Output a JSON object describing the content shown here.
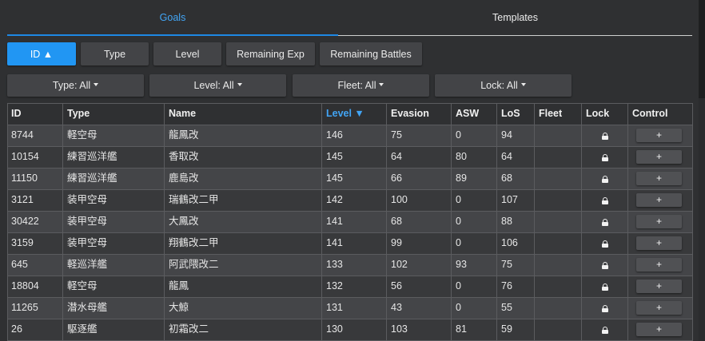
{
  "tabs": [
    {
      "label": "Goals"
    },
    {
      "label": "Templates"
    }
  ],
  "sort_buttons": [
    {
      "label": "ID ▲"
    },
    {
      "label": "Type"
    },
    {
      "label": "Level"
    },
    {
      "label": "Remaining Exp"
    },
    {
      "label": "Remaining Battles"
    }
  ],
  "filters": [
    {
      "label": "Type: All"
    },
    {
      "label": "Level: All"
    },
    {
      "label": "Fleet: All"
    },
    {
      "label": "Lock: All"
    }
  ],
  "table": {
    "headers": [
      "ID",
      "Type",
      "Name",
      "Level ▼",
      "Evasion",
      "ASW",
      "LoS",
      "Fleet",
      "Lock",
      "Control"
    ],
    "rows": [
      [
        "8744",
        "軽空母",
        "龍鳳改",
        "146",
        "75",
        "0",
        "94",
        "",
        "lock",
        "+"
      ],
      [
        "10154",
        "練習巡洋艦",
        "香取改",
        "145",
        "64",
        "80",
        "64",
        "",
        "lock",
        "+"
      ],
      [
        "11150",
        "練習巡洋艦",
        "鹿島改",
        "145",
        "66",
        "89",
        "68",
        "",
        "lock",
        "+"
      ],
      [
        "3121",
        "装甲空母",
        "瑞鶴改二甲",
        "142",
        "100",
        "0",
        "107",
        "",
        "lock",
        "+"
      ],
      [
        "30422",
        "装甲空母",
        "大鳳改",
        "141",
        "68",
        "0",
        "88",
        "",
        "lock",
        "+"
      ],
      [
        "3159",
        "装甲空母",
        "翔鶴改二甲",
        "141",
        "99",
        "0",
        "106",
        "",
        "lock",
        "+"
      ],
      [
        "645",
        "軽巡洋艦",
        "阿武隈改二",
        "133",
        "102",
        "93",
        "75",
        "",
        "lock",
        "+"
      ],
      [
        "18804",
        "軽空母",
        "龍鳳",
        "132",
        "56",
        "0",
        "76",
        "",
        "lock",
        "+"
      ],
      [
        "11265",
        "潜水母艦",
        "大鯨",
        "131",
        "43",
        "0",
        "55",
        "",
        "lock",
        "+"
      ],
      [
        "26",
        "駆逐艦",
        "初霜改二",
        "130",
        "103",
        "81",
        "59",
        "",
        "lock",
        "+"
      ]
    ]
  },
  "colors": {
    "accent": "#2196f3",
    "sorted_header": "#42a5f5"
  }
}
